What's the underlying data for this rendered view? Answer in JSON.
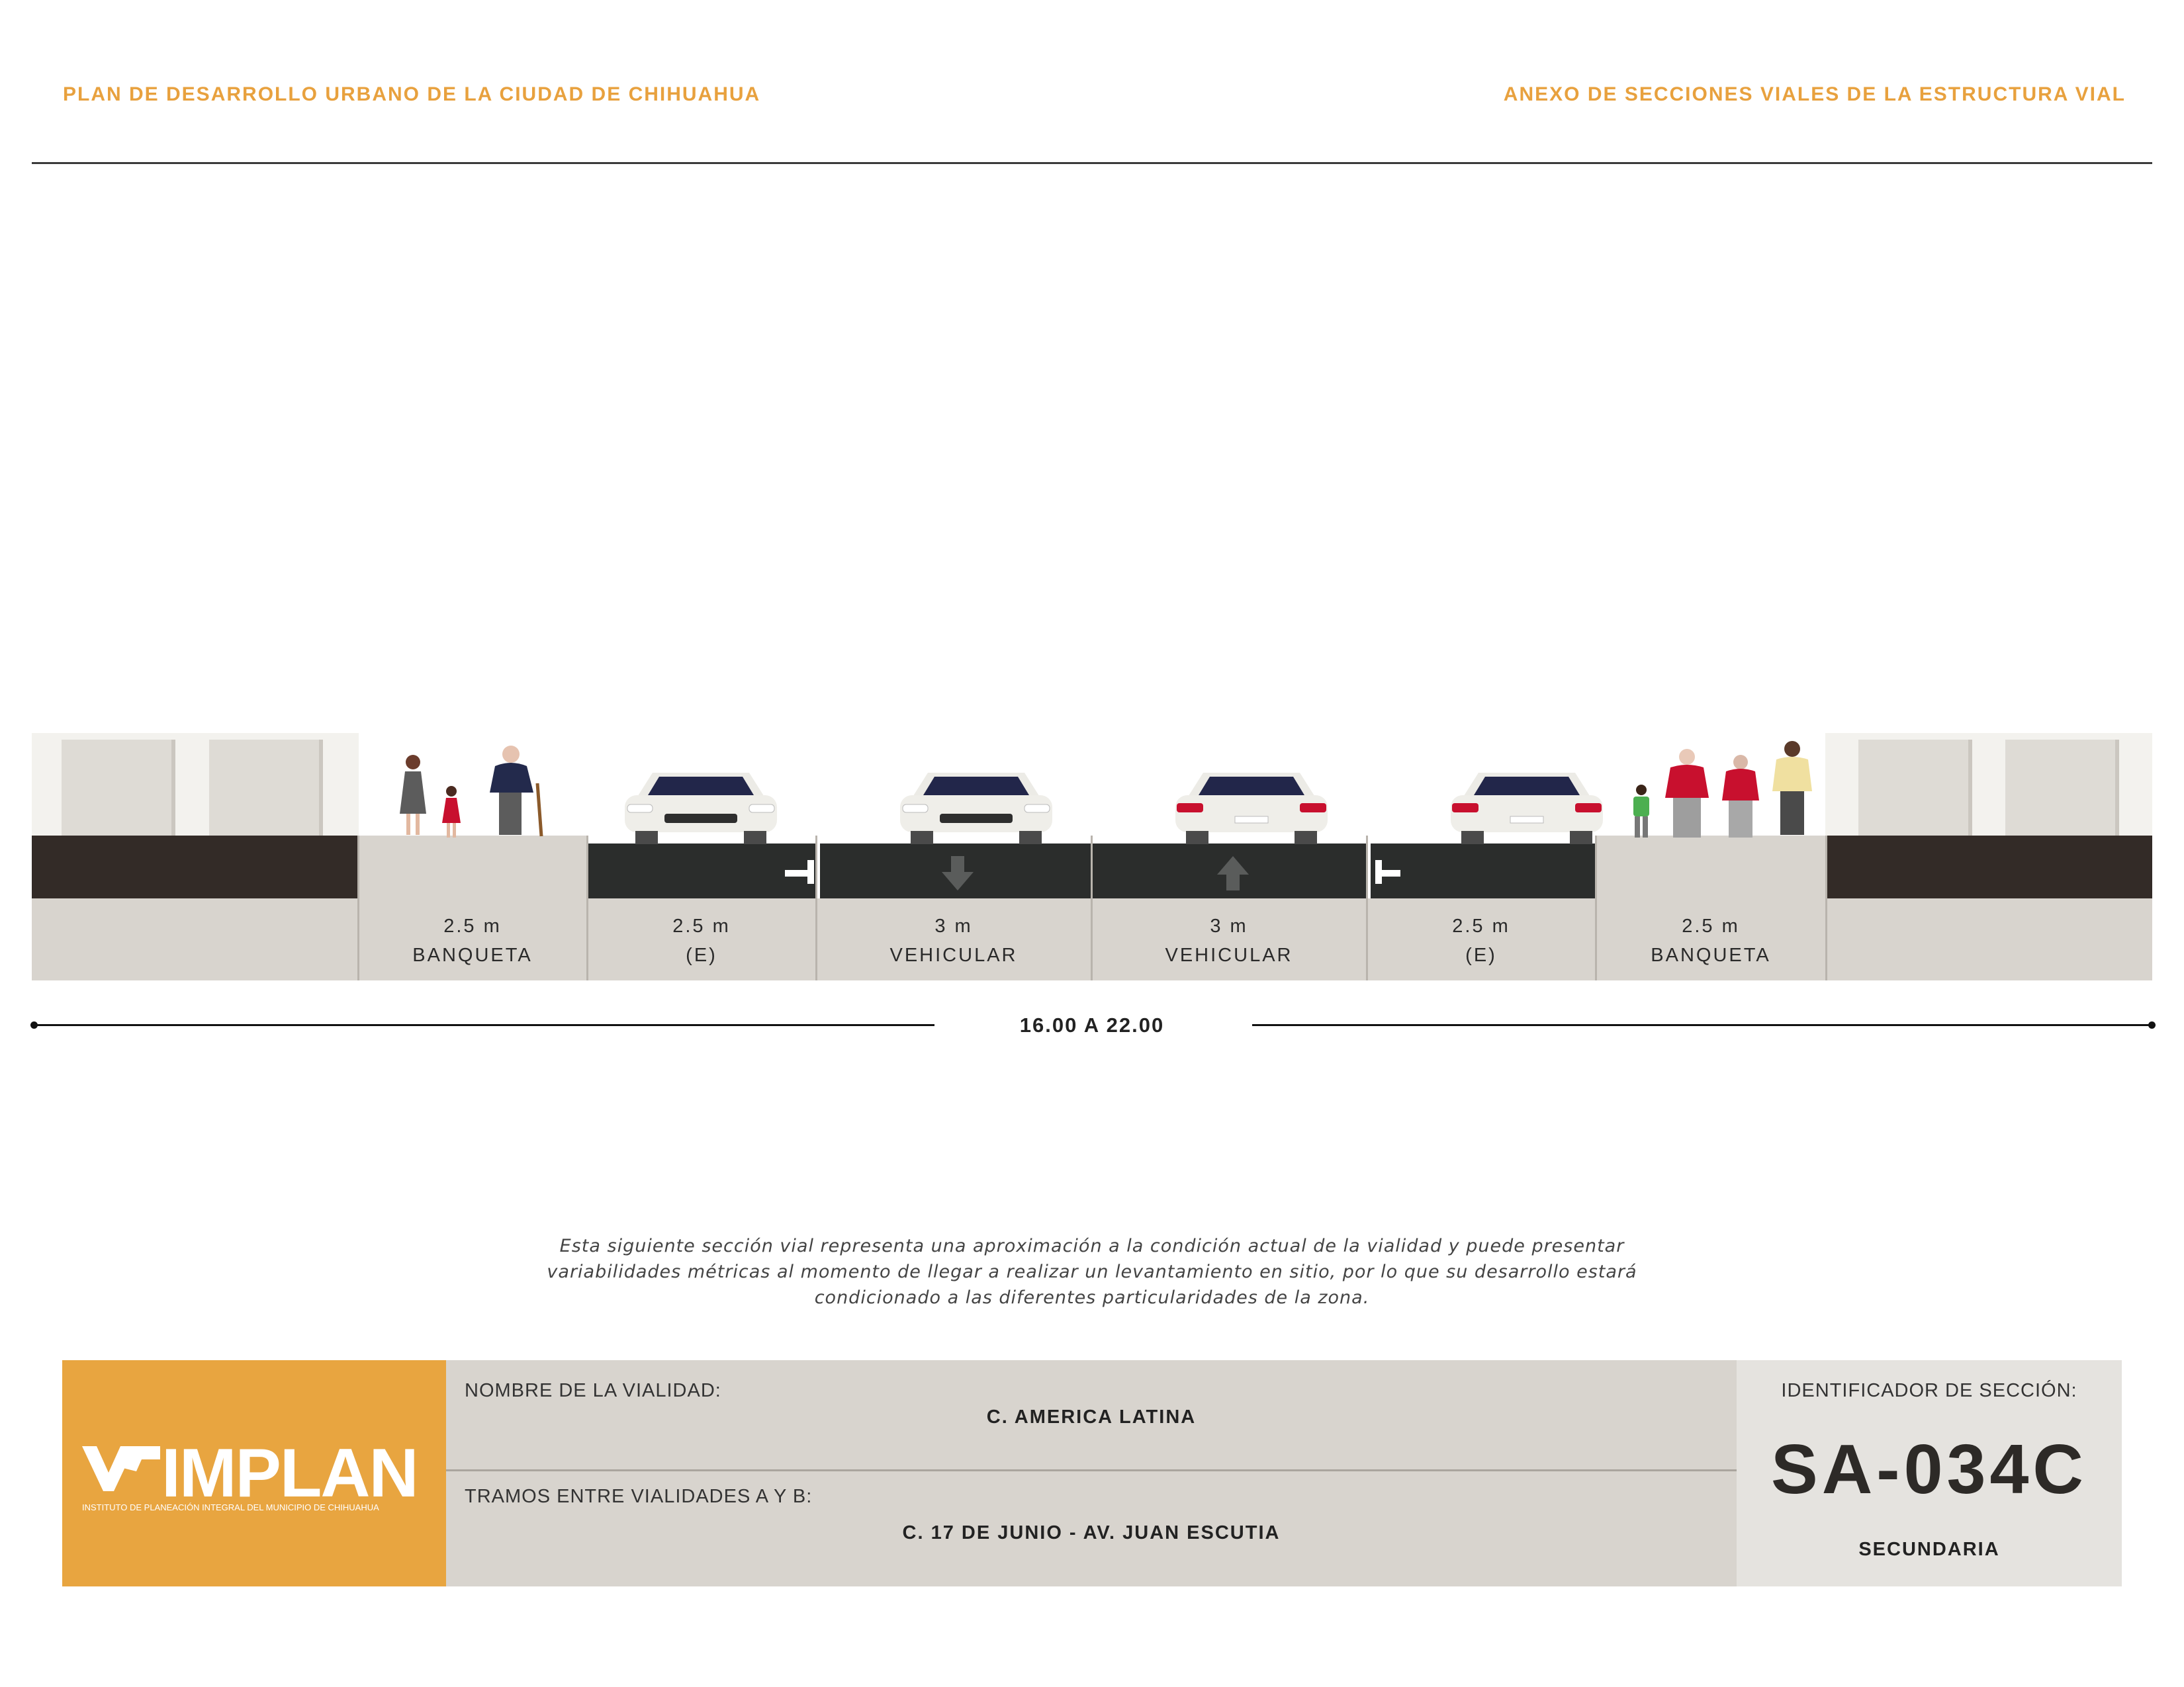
{
  "header": {
    "left_title": "PLAN DE DESARROLLO URBANO DE LA CIUDAD DE CHIHUAHUA",
    "right_title": "ANEXO DE SECCIONES VIALES DE LA ESTRUCTURA VIAL"
  },
  "section": {
    "lanes": [
      {
        "width": "2.5 m",
        "name": "BANQUETA"
      },
      {
        "width": "2.5 m",
        "name": "(E)"
      },
      {
        "width": "3 m",
        "name": "VEHICULAR"
      },
      {
        "width": "3 m",
        "name": "VEHICULAR"
      },
      {
        "width": "2.5 m",
        "name": "(E)"
      },
      {
        "width": "2.5 m",
        "name": "BANQUETA"
      }
    ],
    "total_width": "16.00 A 22.00"
  },
  "note": "Esta siguiente sección vial representa una aproximación a la condición actual de la vialidad y puede presentar variabilidades métricas al momento de llegar a realizar un levantamiento en sitio, por lo que su desarrollo estará condicionado a las diferentes particularidades de la zona.",
  "footer": {
    "logo_text": "IMPLAN",
    "logo_subtitle": "INSTITUTO DE PLANEACIÓN INTEGRAL DEL MUNICIPIO DE CHIHUAHUA",
    "street_name_label": "NOMBRE DE LA VIALIDAD:",
    "street_name": "C. AMERICA LATINA",
    "segment_label": "TRAMOS ENTRE VIALIDADES A Y B:",
    "segment": "C. 17 DE JUNIO - AV. JUAN ESCUTIA",
    "id_label": "IDENTIFICADOR DE SECCIÓN:",
    "id_code": "SA-034C",
    "classification": "SECUNDARIA"
  },
  "colors": {
    "accent": "#e8a13e",
    "asphalt": "#2b2d2c",
    "sidewalk": "#d8d4ce",
    "curb": "#332b27"
  }
}
